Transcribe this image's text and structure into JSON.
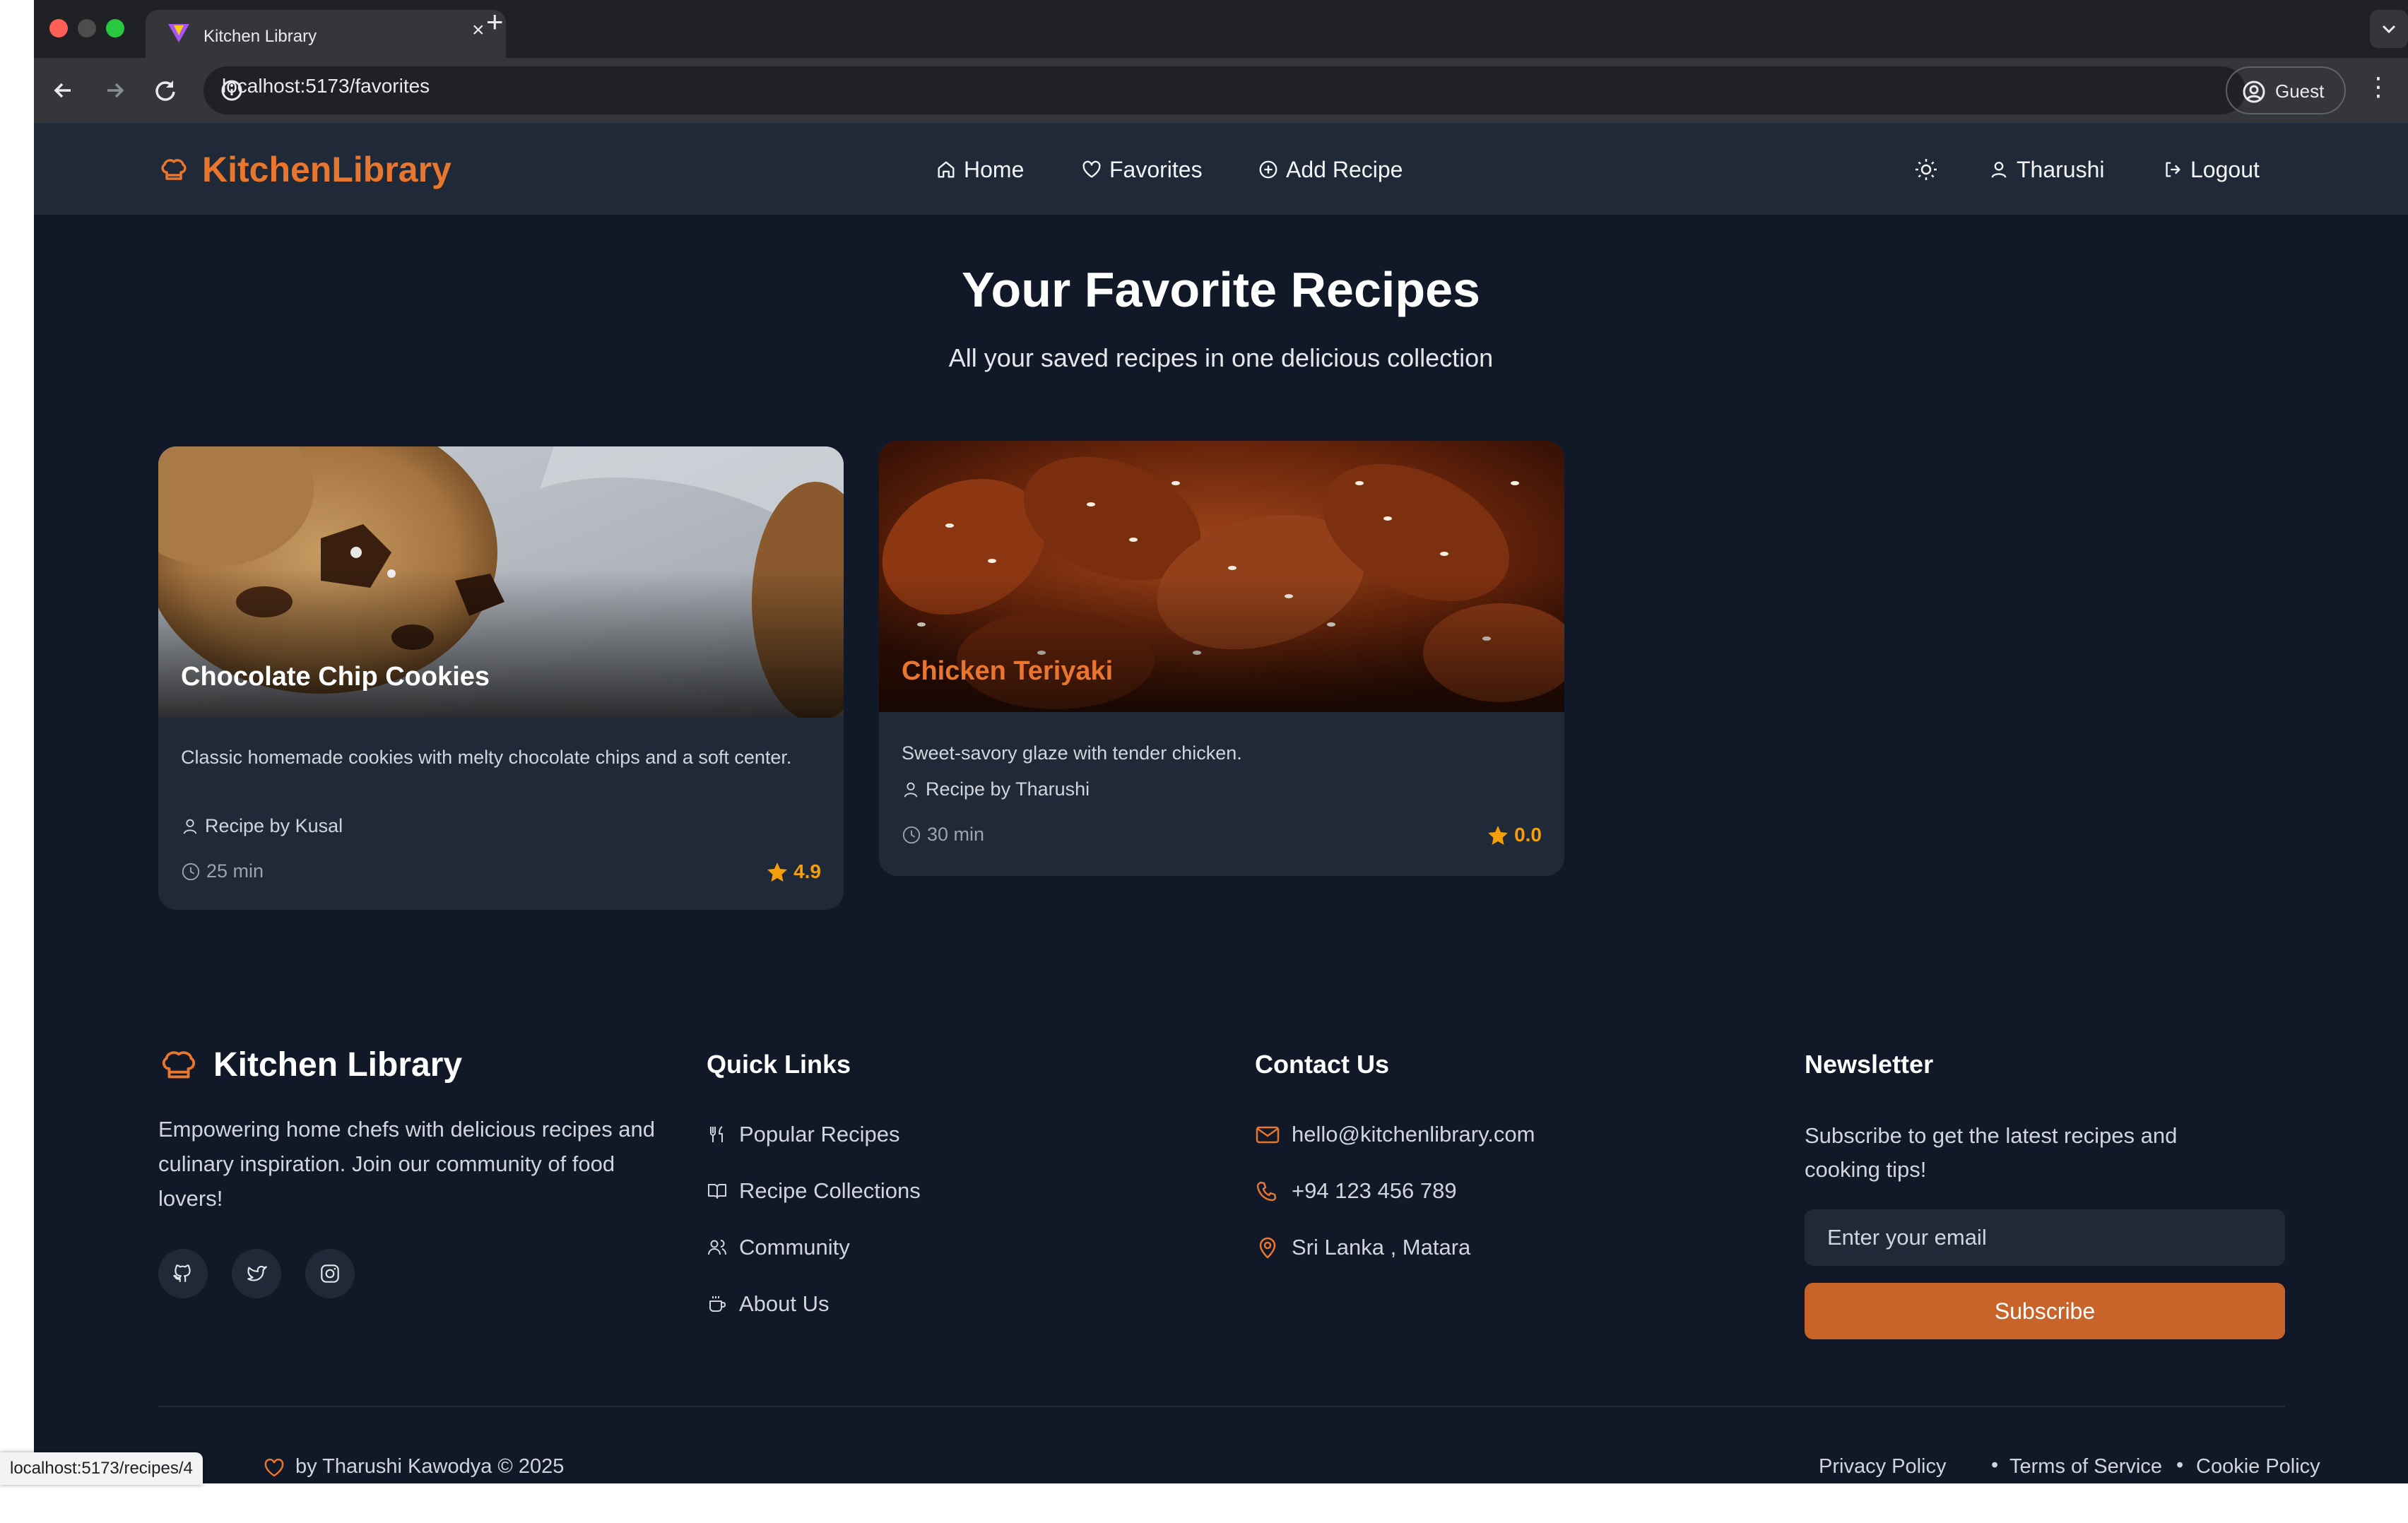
{
  "browser": {
    "tab_title": "Kitchen Library",
    "url": "localhost:5173/favorites",
    "profile_label": "Guest",
    "status_url": "localhost:5173/recipes/4"
  },
  "header": {
    "brand": "KitchenLibrary",
    "nav": [
      {
        "label": "Home",
        "icon": "home-icon"
      },
      {
        "label": "Favorites",
        "icon": "heart-icon"
      },
      {
        "label": "Add Recipe",
        "icon": "plus-circle-icon"
      }
    ],
    "user_name": "Tharushi",
    "logout_label": "Logout"
  },
  "hero": {
    "title": "Your Favorite Recipes",
    "subtitle": "All your saved recipes in one delicious collection"
  },
  "recipes": [
    {
      "title": "Chocolate Chip Cookies",
      "description": "Classic homemade cookies with melty chocolate chips and a soft center.",
      "author": "Recipe by Kusal",
      "time": "25 min",
      "rating": "4.9",
      "title_color": "#ffffff"
    },
    {
      "title": "Chicken Teriyaki",
      "description": "Sweet-savory glaze with tender chicken.",
      "author": "Recipe by Tharushi",
      "time": "30 min",
      "rating": "0.0",
      "title_color": "#e8762f"
    }
  ],
  "footer": {
    "brand": "Kitchen Library",
    "about": "Empowering home chefs with delicious recipes and culinary inspiration. Join our community of food lovers!",
    "quick_links_heading": "Quick Links",
    "quick_links": [
      "Popular Recipes",
      "Recipe Collections",
      "Community",
      "About Us"
    ],
    "contact_heading": "Contact Us",
    "contact": {
      "email": "hello@kitchenlibrary.com",
      "phone": "+94 123 456 789",
      "location": "Sri Lanka , Matara"
    },
    "newsletter_heading": "Newsletter",
    "newsletter_text": "Subscribe to get the latest recipes and cooking tips!",
    "email_placeholder": "Enter your email",
    "subscribe_label": "Subscribe",
    "copyright": "by Tharushi Kawodya © 2025",
    "legal": [
      "Privacy Policy",
      "Terms of Service",
      "Cookie Policy"
    ]
  },
  "colors": {
    "accent": "#e8762f",
    "background": "#111827",
    "surface": "#1f2937",
    "star": "#f59e0b"
  }
}
